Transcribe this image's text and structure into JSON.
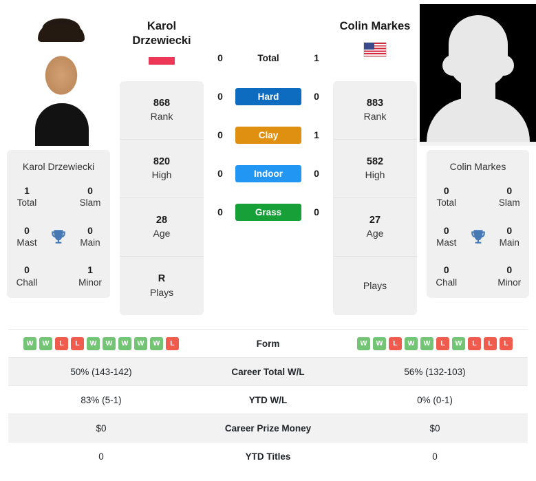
{
  "players": {
    "left": {
      "name_line1": "Karol",
      "name_line2": "Drzewiecki",
      "full_name": "Karol Drzewiecki",
      "flag": "flag-poland",
      "photo": "player-photo",
      "info": [
        {
          "value": "868",
          "label": "Rank"
        },
        {
          "value": "820",
          "label": "High"
        },
        {
          "value": "28",
          "label": "Age"
        },
        {
          "value": "R",
          "label": "Plays"
        }
      ],
      "titles": [
        {
          "value": "1",
          "label": "Total"
        },
        {
          "value": "0",
          "label": "Slam"
        },
        {
          "value": "0",
          "label": "Mast"
        },
        {
          "value": "0",
          "label": "Main"
        },
        {
          "value": "0",
          "label": "Chall"
        },
        {
          "value": "1",
          "label": "Minor"
        }
      ]
    },
    "right": {
      "name_line1": "Colin Markes",
      "name_line2": "",
      "full_name": "Colin Markes",
      "flag": "flag-usa",
      "photo": "player-photo-placeholder",
      "info": [
        {
          "value": "883",
          "label": "Rank"
        },
        {
          "value": "582",
          "label": "High"
        },
        {
          "value": "27",
          "label": "Age"
        },
        {
          "value": "",
          "label": "Plays"
        }
      ],
      "titles": [
        {
          "value": "0",
          "label": "Total"
        },
        {
          "value": "0",
          "label": "Slam"
        },
        {
          "value": "0",
          "label": "Mast"
        },
        {
          "value": "0",
          "label": "Main"
        },
        {
          "value": "0",
          "label": "Chall"
        },
        {
          "value": "0",
          "label": "Minor"
        }
      ]
    }
  },
  "trophy_icon": "trophy-icon",
  "surfaces": [
    {
      "label": "Total",
      "left": "0",
      "right": "1",
      "color": "",
      "pill": false
    },
    {
      "label": "Hard",
      "left": "0",
      "right": "0",
      "color": "#0d6cc0",
      "pill": true
    },
    {
      "label": "Clay",
      "left": "0",
      "right": "1",
      "color": "#e09010",
      "pill": true
    },
    {
      "label": "Indoor",
      "left": "0",
      "right": "0",
      "color": "#2196f3",
      "pill": true
    },
    {
      "label": "Grass",
      "left": "0",
      "right": "0",
      "color": "#17a038",
      "pill": true
    }
  ],
  "table": {
    "rows": [
      {
        "label": "Form",
        "type": "form",
        "left_form": [
          "W",
          "W",
          "L",
          "L",
          "W",
          "W",
          "W",
          "W",
          "W",
          "L"
        ],
        "right_form": [
          "W",
          "W",
          "L",
          "W",
          "W",
          "L",
          "W",
          "L",
          "L",
          "L"
        ],
        "shaded": false
      },
      {
        "label": "Career Total W/L",
        "type": "text",
        "left": "50% (143-142)",
        "right": "56% (132-103)",
        "shaded": true
      },
      {
        "label": "YTD W/L",
        "type": "text",
        "left": "83% (5-1)",
        "right": "0% (0-1)",
        "shaded": false
      },
      {
        "label": "Career Prize Money",
        "type": "text",
        "left": "$0",
        "right": "$0",
        "shaded": true
      },
      {
        "label": "YTD Titles",
        "type": "text",
        "left": "0",
        "right": "0",
        "shaded": false
      }
    ]
  },
  "colors": {
    "hard": "#0d6cc0",
    "clay": "#e09010",
    "indoor": "#2196f3",
    "grass": "#17a038",
    "win": "#74c476",
    "loss": "#ef5b4c",
    "card": "#f0f0f0",
    "trophy": "#4678b4"
  }
}
